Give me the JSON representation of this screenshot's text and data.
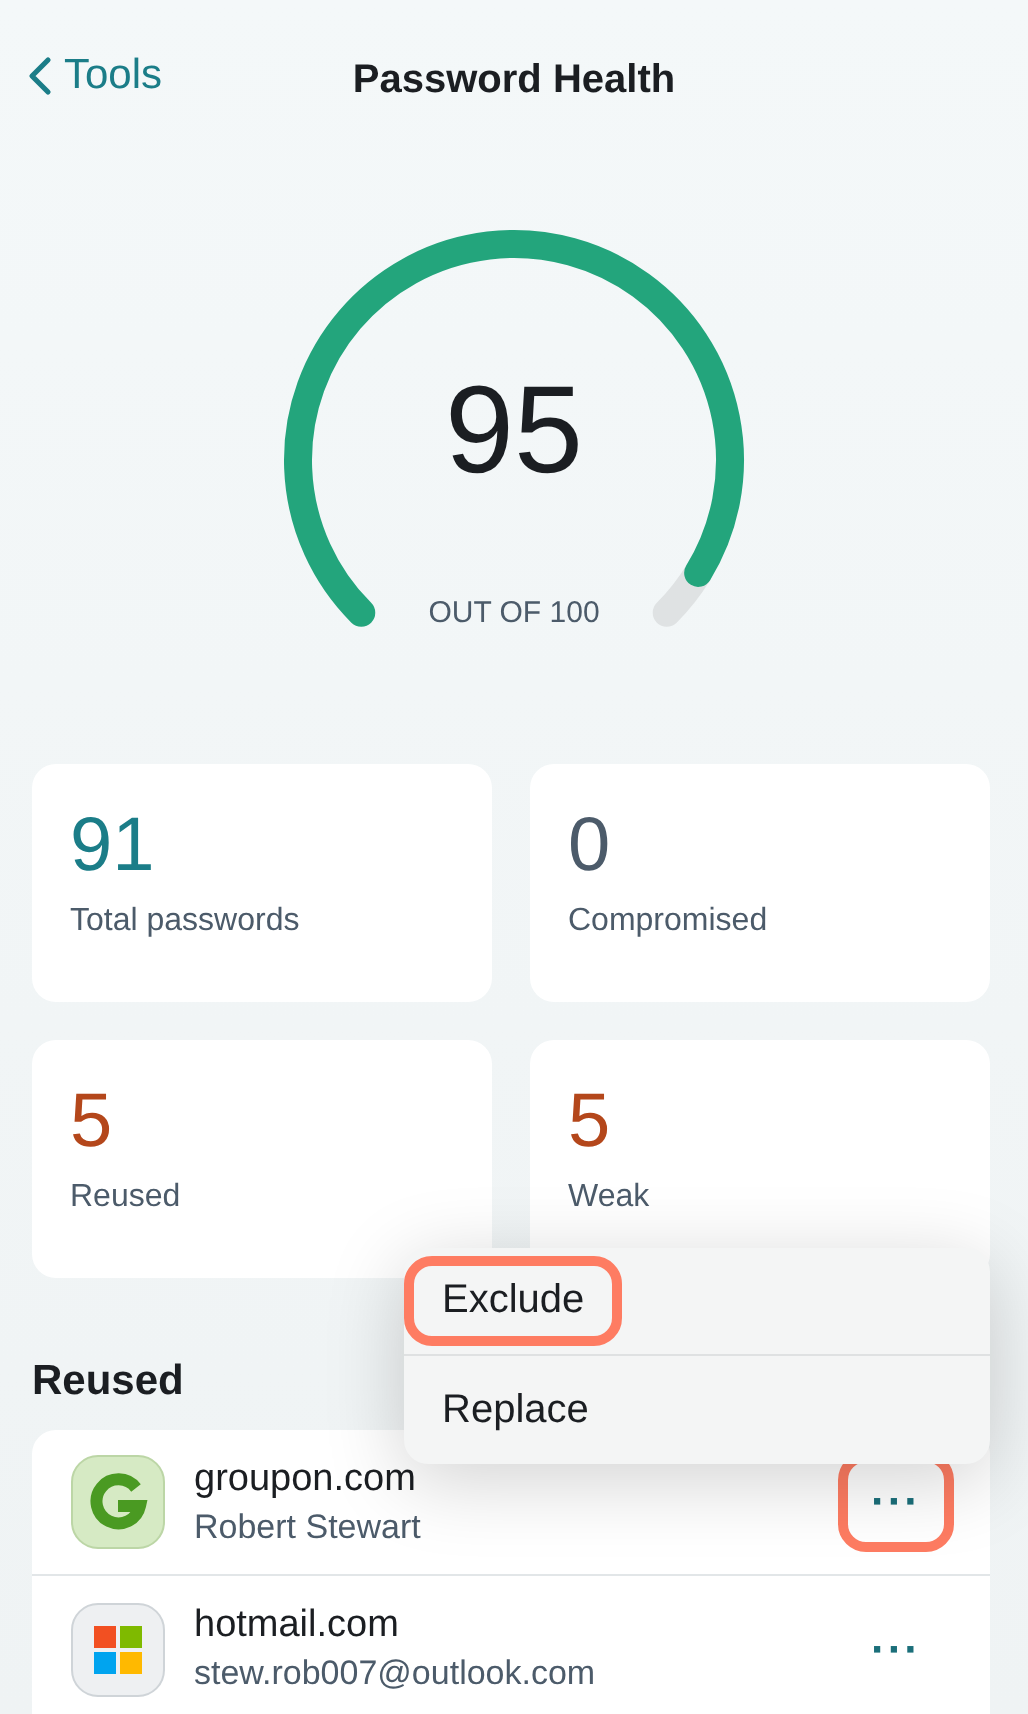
{
  "header": {
    "back_label": "Tools",
    "title": "Password Health"
  },
  "score": {
    "value": "95",
    "caption": "OUT OF 100"
  },
  "stats": [
    {
      "value": "91",
      "label": "Total passwords",
      "color": "#1b7d88"
    },
    {
      "value": "0",
      "label": "Compromised",
      "color": "#4c5b6a"
    },
    {
      "value": "5",
      "label": "Reused",
      "color": "#b4471b"
    },
    {
      "value": "5",
      "label": "Weak",
      "color": "#b4471b"
    }
  ],
  "section_title": "Reused",
  "accounts": [
    {
      "site": "groupon.com",
      "user": "Robert Stewart",
      "kind": "groupon",
      "more": "···",
      "highlighted": true
    },
    {
      "site": "hotmail.com",
      "user": "stew.rob007@outlook.com",
      "kind": "windows",
      "more": "···",
      "highlighted": false
    }
  ],
  "menu": [
    {
      "label": "Exclude",
      "highlighted": true
    },
    {
      "label": "Replace",
      "highlighted": false
    }
  ]
}
